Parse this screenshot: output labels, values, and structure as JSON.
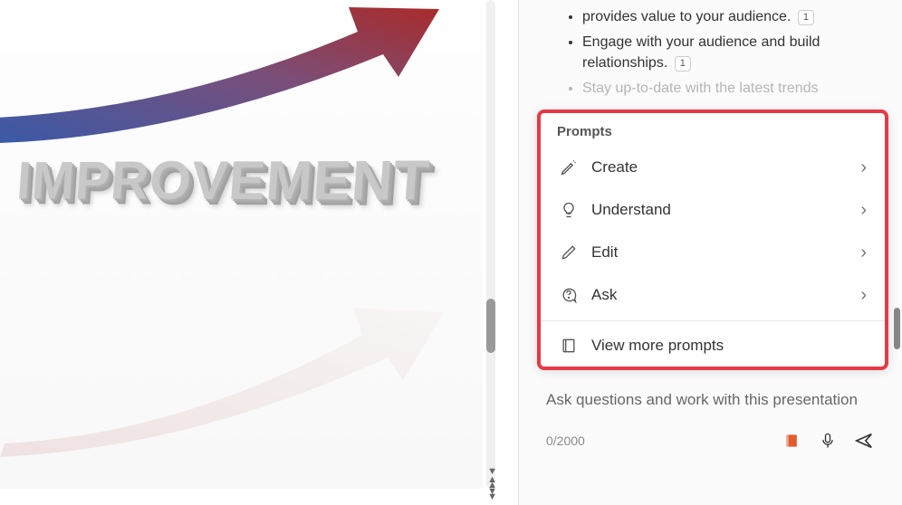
{
  "slide": {
    "word": "IMPROVEMENT"
  },
  "sidebar": {
    "bullets": [
      {
        "text": "provides value to your audience.",
        "ref": "1"
      },
      {
        "text": "Engage with your audience and build relationships.",
        "ref": "1"
      },
      {
        "text_truncated": "Stay up-to-date with the latest trends"
      }
    ]
  },
  "prompts": {
    "header": "Prompts",
    "items": [
      {
        "label": "Create",
        "icon": "pen-sparkle-icon"
      },
      {
        "label": "Understand",
        "icon": "lightbulb-icon"
      },
      {
        "label": "Edit",
        "icon": "pencil-icon"
      },
      {
        "label": "Ask",
        "icon": "chat-question-icon"
      }
    ],
    "more": "View more prompts"
  },
  "input": {
    "placeholder": "Ask questions and work with this presentation",
    "char_count": "0/2000"
  },
  "highlight_color": "#e63946"
}
